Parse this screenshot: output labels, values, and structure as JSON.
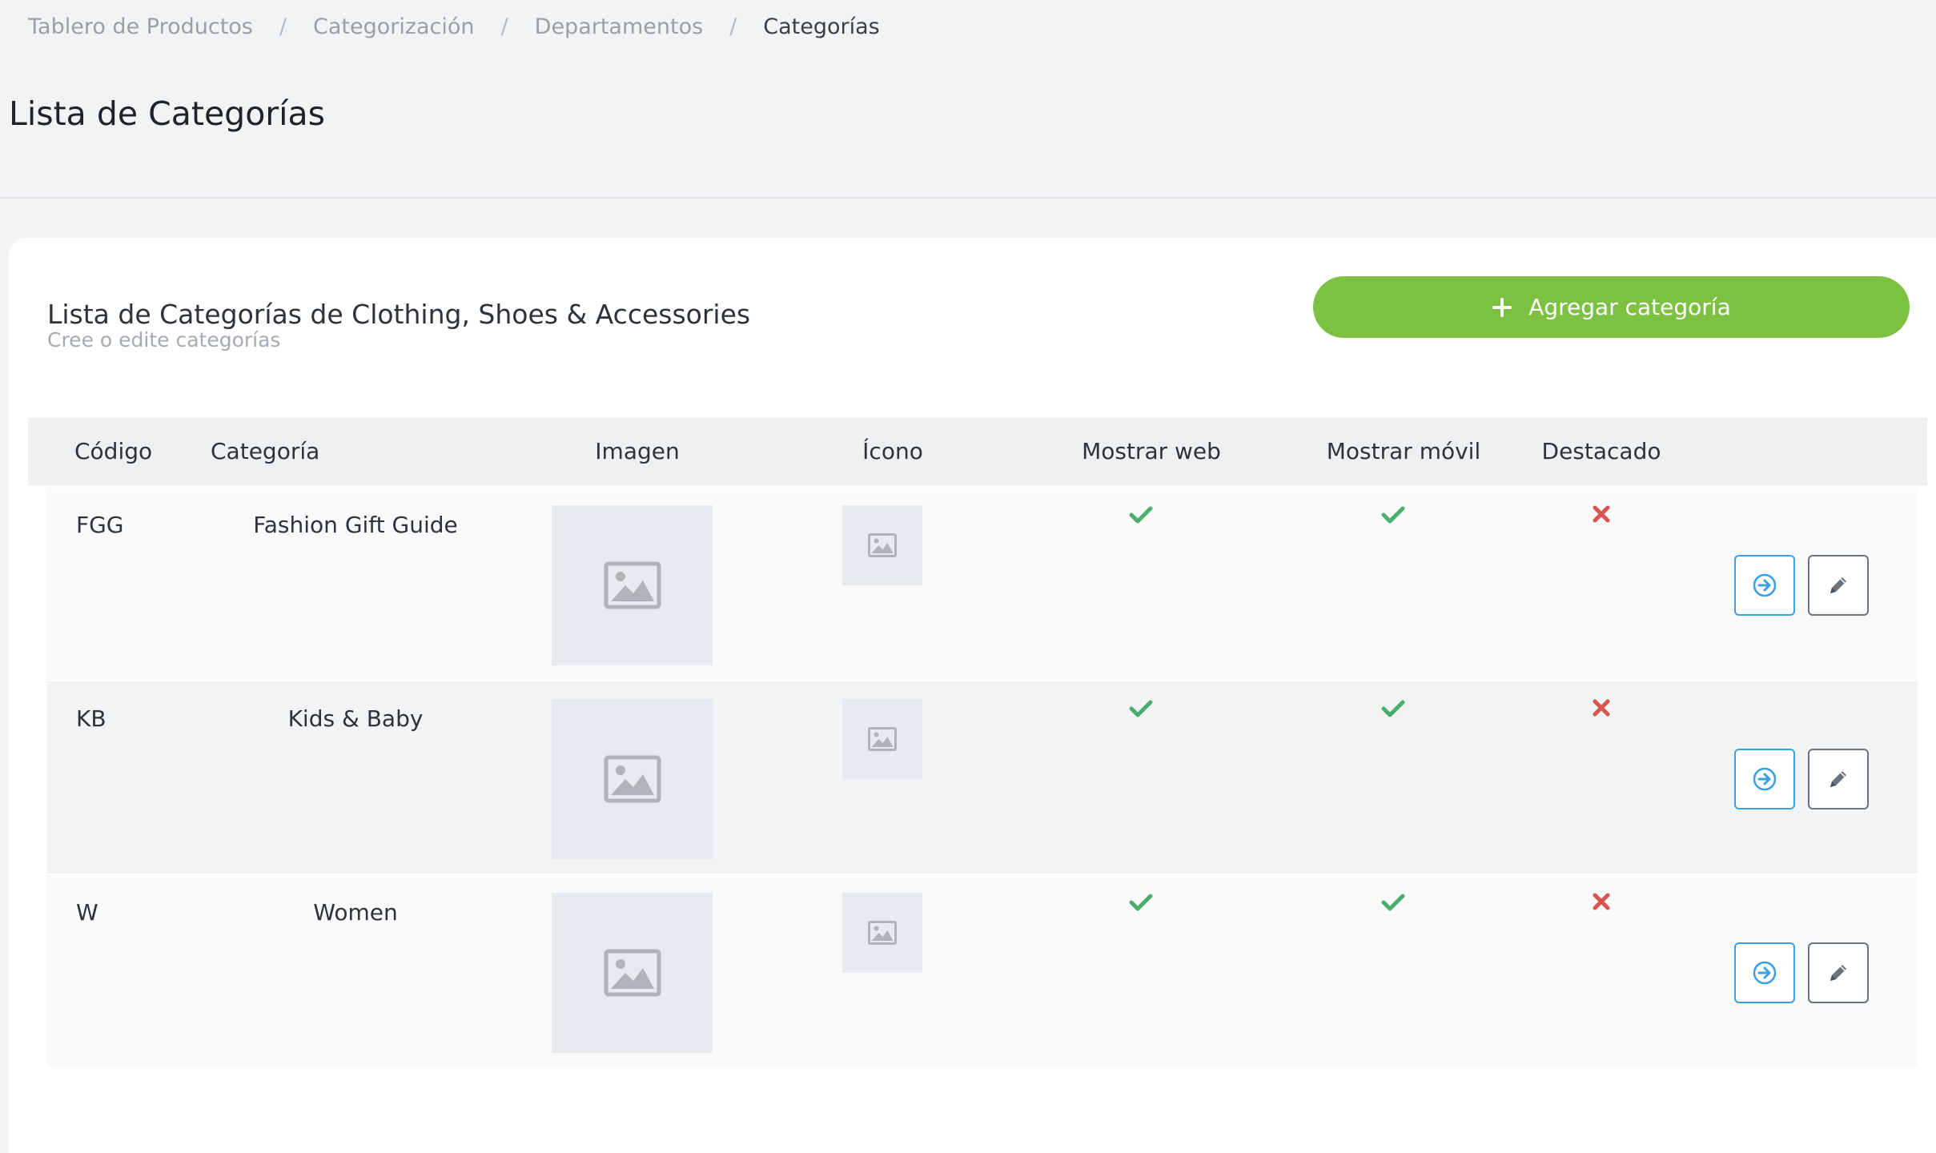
{
  "breadcrumb": {
    "items": [
      "Tablero de Productos",
      "Categorización",
      "Departamentos",
      "Categorías"
    ],
    "separator": "/"
  },
  "page": {
    "title": "Lista de Categorías"
  },
  "card": {
    "title": "Lista de Categorías de Clothing, Shoes & Accessories",
    "subtitle": "Cree o edite categorías",
    "add_button_label": "Agregar categoría"
  },
  "table": {
    "headers": {
      "code": "Código",
      "category": "Categoría",
      "image": "Imagen",
      "icon": "Ícono",
      "show_web": "Mostrar web",
      "show_mobile": "Mostrar móvil",
      "featured": "Destacado"
    },
    "rows": [
      {
        "code": "FGG",
        "category": "Fashion Gift Guide",
        "show_web": true,
        "show_mobile": true,
        "featured": false
      },
      {
        "code": "KB",
        "category": "Kids & Baby",
        "show_web": true,
        "show_mobile": true,
        "featured": false
      },
      {
        "code": "W",
        "category": "Women",
        "show_web": true,
        "show_mobile": true,
        "featured": false
      }
    ]
  },
  "colors": {
    "accent_green": "#7dc142",
    "check_green": "#4cae6e",
    "cross_red": "#d9534f",
    "nav_blue": "#3aa0e6",
    "edit_gray": "#6b737b"
  },
  "icons": {
    "add": "plus-icon",
    "image": "image-placeholder-icon",
    "true": "check-icon",
    "false": "cross-icon",
    "navigate": "arrow-right-circle-icon",
    "edit": "pencil-icon"
  }
}
